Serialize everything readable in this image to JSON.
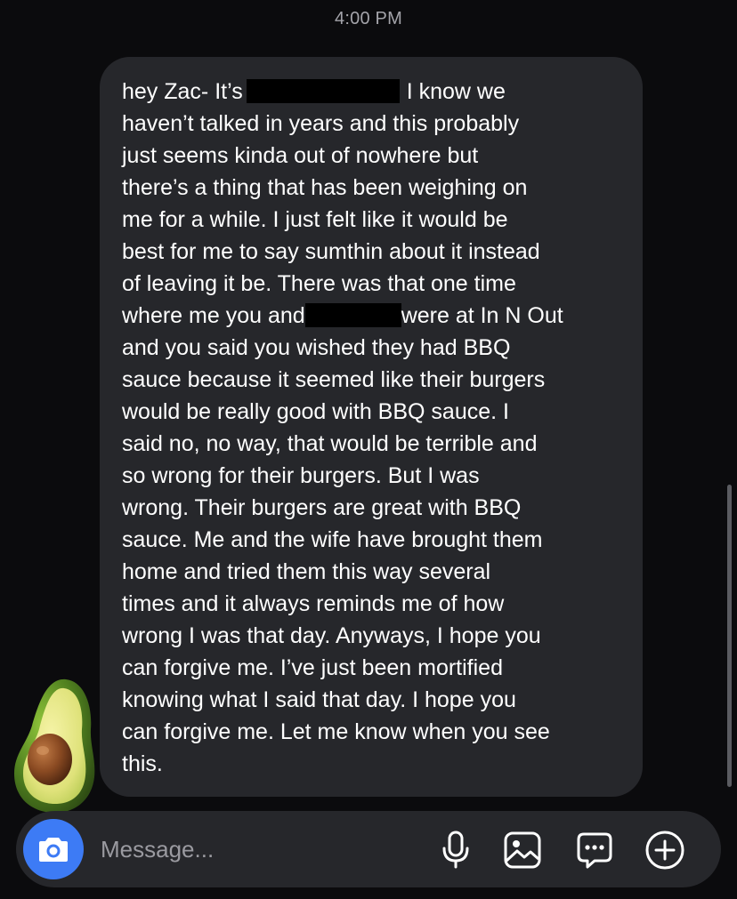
{
  "header": {
    "timestamp": "4:00 PM"
  },
  "message": {
    "lines": [
      {
        "before": "hey Zac- It’s",
        "after": "I know we"
      },
      {
        "text": "haven’t talked in years and this probably"
      },
      {
        "text": "just seems kinda out of nowhere but"
      },
      {
        "text": "there’s a thing that has been weighing on"
      },
      {
        "text": "me for a while. I just felt like it would be"
      },
      {
        "text": "best for me to say sumthin about it instead"
      },
      {
        "text": "of leaving it be. There was that one time"
      },
      {
        "before": "where me you and",
        "after": "were at In N Out"
      },
      {
        "text": "and you said you wished they had BBQ"
      },
      {
        "text": "sauce because it seemed like their burgers"
      },
      {
        "text": "would be really good with BBQ sauce. I"
      },
      {
        "text": "said no, no way, that would be terrible and"
      },
      {
        "text": "so wrong for their burgers. But I was"
      },
      {
        "text": "wrong. Their burgers are great with BBQ"
      },
      {
        "text": "sauce. Me and the wife have brought them"
      },
      {
        "text": "home and tried them this way several"
      },
      {
        "text": "times and it always reminds me of how"
      },
      {
        "text": "wrong I was that day. Anyways, I hope you"
      },
      {
        "text": "can forgive me. I’ve just been mortified"
      },
      {
        "text": "knowing what I said that day. I hope you"
      },
      {
        "text": "can forgive me. Let me know when you see"
      },
      {
        "text": "this."
      }
    ]
  },
  "reaction": {
    "icon": "avocado-icon"
  },
  "composer": {
    "placeholder": "Message...",
    "value": "",
    "icons": [
      "camera-icon",
      "microphone-icon",
      "gallery-icon",
      "sticker-icon",
      "plus-icon"
    ]
  },
  "colors": {
    "accent": "#3d7bf5",
    "bubble": "#26272b",
    "background": "#0b0b0d"
  }
}
